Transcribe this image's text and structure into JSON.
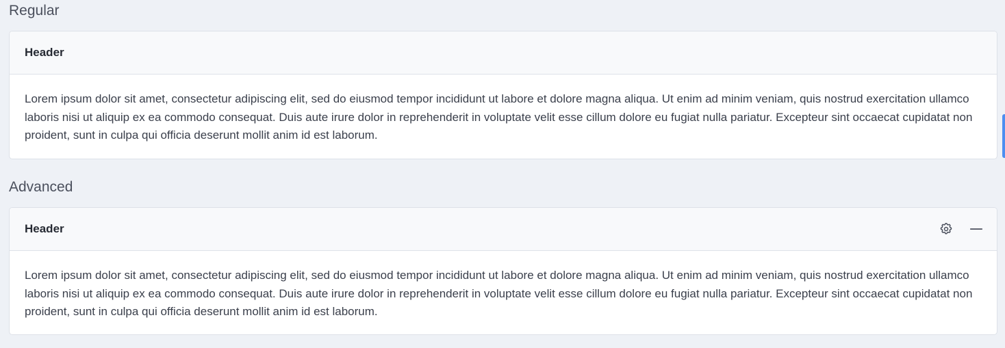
{
  "regular": {
    "section_title": "Regular",
    "card": {
      "header_title": "Header",
      "body_text": "Lorem ipsum dolor sit amet, consectetur adipiscing elit, sed do eiusmod tempor incididunt ut labore et dolore magna aliqua. Ut enim ad minim veniam, quis nostrud exercitation ullamco laboris nisi ut aliquip ex ea commodo consequat. Duis aute irure dolor in reprehenderit in voluptate velit esse cillum dolore eu fugiat nulla pariatur. Excepteur sint occaecat cupidatat non proident, sunt in culpa qui officia deserunt mollit anim id est laborum."
    }
  },
  "advanced": {
    "section_title": "Advanced",
    "card": {
      "header_title": "Header",
      "tools": [
        {
          "icon": "gear-icon",
          "action": "settings"
        },
        {
          "icon": "minus-icon",
          "action": "collapse"
        }
      ],
      "body_text": "Lorem ipsum dolor sit amet, consectetur adipiscing elit, sed do eiusmod tempor incididunt ut labore et dolore magna aliqua. Ut enim ad minim veniam, quis nostrud exercitation ullamco laboris nisi ut aliquip ex ea commodo consequat. Duis aute irure dolor in reprehenderit in voluptate velit esse cillum dolore eu fugiat nulla pariatur. Excepteur sint occaecat cupidatat non proident, sunt in culpa qui officia deserunt mollit anim id est laborum."
    }
  },
  "colors": {
    "page_background": "#eef1f6",
    "card_header_background": "#f8f9fb",
    "border": "#dde1e8",
    "accent": "#4d8ef0"
  }
}
